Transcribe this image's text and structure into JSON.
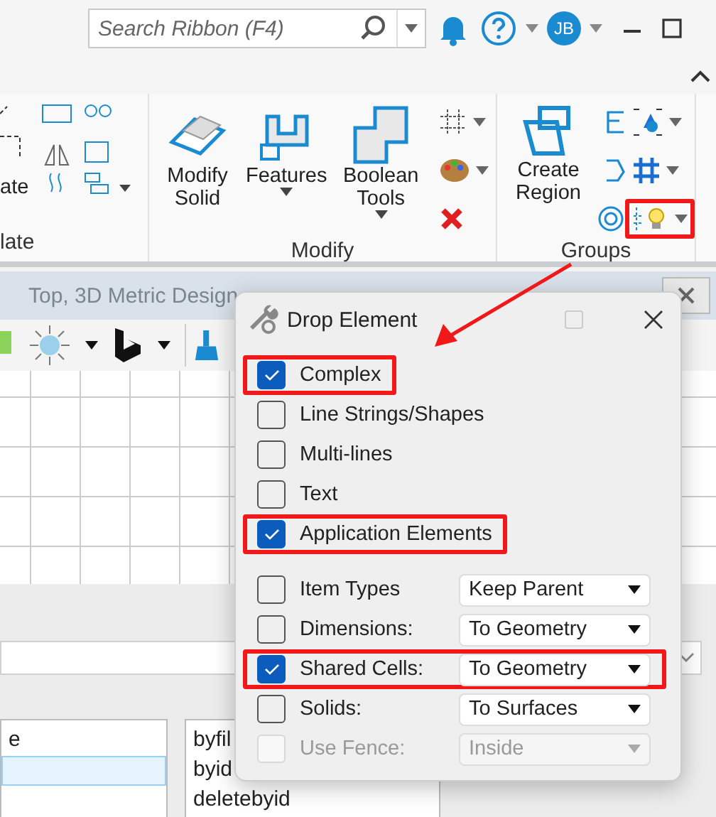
{
  "top_bar": {
    "search_placeholder": "Search Ribbon (F4)",
    "user_initials": "JB"
  },
  "ribbon": {
    "groups": [
      {
        "label": "late",
        "large_buttons": [
          {
            "label": "ate",
            "caret": false
          }
        ]
      },
      {
        "label": "Modify",
        "large_buttons": [
          {
            "label": "Modify Solid",
            "caret": false
          },
          {
            "label": "Features",
            "caret": true
          },
          {
            "label": "Boolean Tools",
            "caret": true
          }
        ]
      },
      {
        "label": "Groups",
        "large_buttons": [
          {
            "label": "Create Region",
            "caret": false
          }
        ]
      }
    ],
    "highlighted_tool": true
  },
  "background_window": {
    "title": "Top, 3D Metric Design",
    "list_1": [
      {
        "text": "e",
        "selected": false
      },
      {
        "selected": true
      }
    ],
    "list_2": [
      {
        "text": "byfil",
        "selected": false
      },
      {
        "text": "byid",
        "selected": false
      },
      {
        "text": "deletebyid",
        "selected": false
      }
    ]
  },
  "dialog": {
    "title": "Drop Element",
    "options": [
      {
        "kind": "checkbox",
        "label": "Complex",
        "checked": true,
        "disabled": false,
        "highlighted": true
      },
      {
        "kind": "checkbox",
        "label": "Line Strings/Shapes",
        "checked": false,
        "disabled": false,
        "highlighted": false
      },
      {
        "kind": "checkbox",
        "label": "Multi-lines",
        "checked": false,
        "disabled": false,
        "highlighted": false
      },
      {
        "kind": "checkbox",
        "label": "Text",
        "checked": false,
        "disabled": false,
        "highlighted": false
      },
      {
        "kind": "checkbox",
        "label": "Application Elements",
        "checked": true,
        "disabled": false,
        "highlighted": true
      },
      {
        "kind": "select",
        "label": "Item Types",
        "value": "Keep Parent",
        "checked": false,
        "disabled": false,
        "highlighted": false
      },
      {
        "kind": "select",
        "label": "Dimensions:",
        "value": "To Geometry",
        "checked": false,
        "disabled": false,
        "highlighted": false
      },
      {
        "kind": "select",
        "label": "Shared Cells:",
        "value": "To Geometry",
        "checked": true,
        "disabled": false,
        "highlighted": true
      },
      {
        "kind": "select",
        "label": "Solids:",
        "value": "To Surfaces",
        "checked": false,
        "disabled": false,
        "highlighted": false
      },
      {
        "kind": "select",
        "label": "Use Fence:",
        "value": "Inside",
        "checked": false,
        "disabled": true,
        "highlighted": false
      }
    ]
  },
  "annotation_arrow": true
}
